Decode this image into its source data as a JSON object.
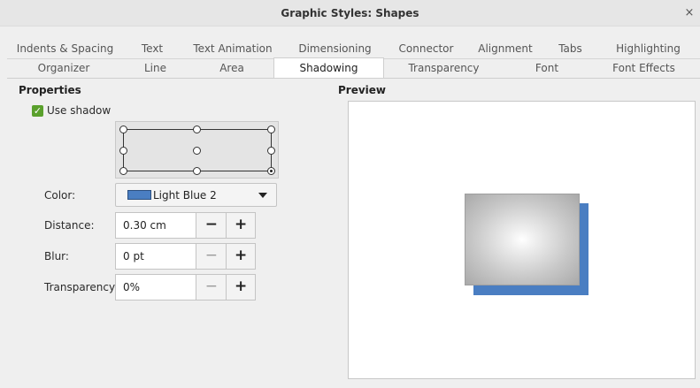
{
  "window": {
    "title": "Graphic Styles: Shapes",
    "close_glyph": "×"
  },
  "tabs_row1": [
    "Indents & Spacing",
    "Text",
    "Text Animation",
    "Dimensioning",
    "Connector",
    "Alignment",
    "Tabs",
    "Highlighting"
  ],
  "tabs_row2": [
    "Organizer",
    "Line",
    "Area",
    "Shadowing",
    "Transparency",
    "Font",
    "Font Effects"
  ],
  "active_tab": "Shadowing",
  "properties": {
    "title": "Properties",
    "use_shadow": {
      "label": "Use shadow",
      "checked": true
    },
    "position_selected": "bottom-right",
    "color": {
      "label": "Color:",
      "value": "Light Blue 2",
      "swatch": "#4a7ec2"
    },
    "distance": {
      "label": "Distance:",
      "value": "0.30 cm"
    },
    "blur": {
      "label": "Blur:",
      "value": "0 pt"
    },
    "transparency": {
      "label": "Transparency:",
      "value": "0%"
    },
    "minus_glyph": "−",
    "plus_glyph": "+"
  },
  "preview": {
    "title": "Preview",
    "shadow_color": "#4a7ec2"
  }
}
